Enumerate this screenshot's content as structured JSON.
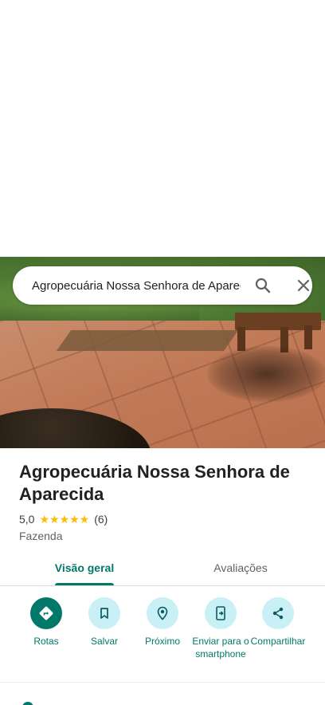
{
  "search": {
    "query": "Agropecuária Nossa Senhora de Aparecida"
  },
  "place": {
    "title": "Agropecuária Nossa Senhora de Aparecida",
    "rating": "5,0",
    "stars": "★★★★★",
    "review_count": "(6)",
    "category": "Fazenda"
  },
  "tabs": [
    {
      "label": "Visão geral",
      "selected": true
    },
    {
      "label": "Avaliações",
      "selected": false
    }
  ],
  "actions": [
    {
      "label": "Rotas",
      "icon": "directions-icon"
    },
    {
      "label": "Salvar",
      "icon": "bookmark-icon"
    },
    {
      "label": "Próximo",
      "icon": "nearby-icon"
    },
    {
      "label": "Enviar para o smartphone",
      "icon": "send-to-phone-icon"
    },
    {
      "label": "Compartilhar",
      "icon": "share-icon"
    }
  ],
  "colors": {
    "accent": "#00796b",
    "action_bg": "#c8f0f5",
    "star": "#fbbc04"
  }
}
